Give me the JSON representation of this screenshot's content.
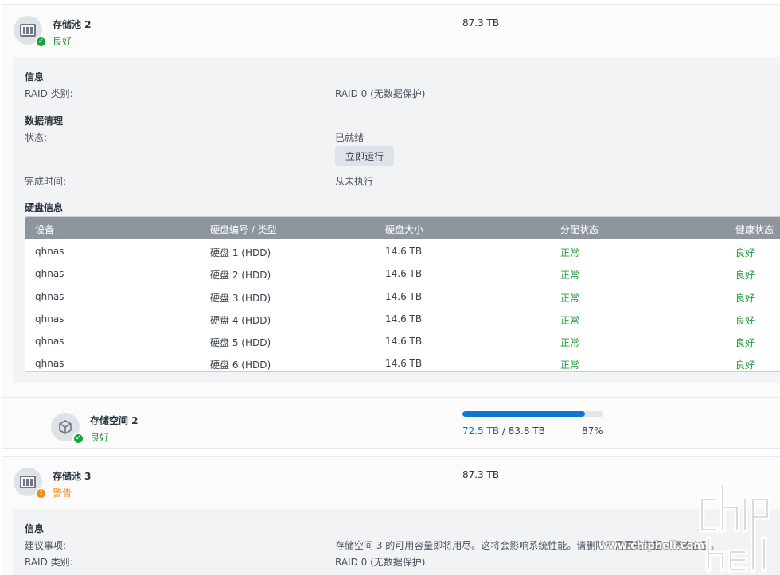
{
  "pool2": {
    "name": "存储池 2",
    "status": "良好",
    "size": "87.3 TB",
    "info_title": "信息",
    "raid_label": "RAID 类别:",
    "raid_value": "RAID 0 (无数据保护)",
    "scrub_title": "数据清理",
    "scrub_status_label": "状态:",
    "scrub_status_value": "已就绪",
    "run_now_label": "立即运行",
    "completed_label": "完成时间:",
    "completed_value": "从未执行",
    "disk_info_title": "硬盘信息",
    "disk_table": {
      "headers": [
        "设备",
        "硬盘编号 / 类型",
        "硬盘大小",
        "分配状态",
        "健康状态"
      ],
      "rows": [
        [
          "qhnas",
          "硬盘 1 (HDD)",
          "14.6 TB",
          "正常",
          "良好"
        ],
        [
          "qhnas",
          "硬盘 2 (HDD)",
          "14.6 TB",
          "正常",
          "良好"
        ],
        [
          "qhnas",
          "硬盘 3 (HDD)",
          "14.6 TB",
          "正常",
          "良好"
        ],
        [
          "qhnas",
          "硬盘 4 (HDD)",
          "14.6 TB",
          "正常",
          "良好"
        ],
        [
          "qhnas",
          "硬盘 5 (HDD)",
          "14.6 TB",
          "正常",
          "良好"
        ],
        [
          "qhnas",
          "硬盘 6 (HDD)",
          "14.6 TB",
          "正常",
          "良好"
        ]
      ]
    },
    "volume": {
      "name": "存储空间 2",
      "status": "良好",
      "used": "72.5 TB",
      "separator": " / ",
      "total": "83.8 TB",
      "percent_label": "87%",
      "usage_fraction": 0.87
    }
  },
  "pool3": {
    "name": "存储池 3",
    "status": "警告",
    "size": "87.3 TB",
    "info_title": "信息",
    "suggestion_label": "建议事项:",
    "suggestion_value": "存储空间 3 的可用容量即将用尽。这将会影响系统性能。请删除不需要的数据以释放容量。",
    "raid_label": "RAID 类别:",
    "raid_value": "RAID 0 (无数据保护)"
  },
  "watermark": {
    "url": "www.chiphell.com"
  },
  "colors": {
    "good": "#249d3b",
    "warning": "#f08c19",
    "accent": "#1076d4",
    "table_header": "#8e959d"
  },
  "icons": {
    "pool": "storage-pool-icon",
    "volume": "volume-cube-icon",
    "ok_badge": "check-badge-icon",
    "warn_badge": "warning-badge-icon"
  }
}
